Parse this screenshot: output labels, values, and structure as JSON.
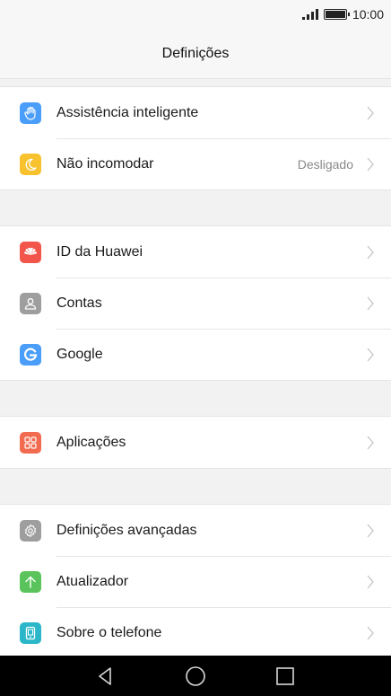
{
  "status_bar": {
    "time": "10:00"
  },
  "header": {
    "title": "Definições"
  },
  "groups": [
    {
      "items": [
        {
          "label": "Assistência inteligente",
          "value": "",
          "icon": "hand-icon",
          "color": "#4a9df8"
        },
        {
          "label": "Não incomodar",
          "value": "Desligado",
          "icon": "moon-icon",
          "color": "#f7c22e"
        }
      ]
    },
    {
      "items": [
        {
          "label": "ID da Huawei",
          "value": "",
          "icon": "huawei-icon",
          "color": "#f2564a"
        },
        {
          "label": "Contas",
          "value": "",
          "icon": "user-icon",
          "color": "#9e9e9e"
        },
        {
          "label": "Google",
          "value": "",
          "icon": "google-icon",
          "color": "#4a9df8"
        }
      ]
    },
    {
      "items": [
        {
          "label": "Aplicações",
          "value": "",
          "icon": "apps-icon",
          "color": "#f26a4f"
        }
      ]
    },
    {
      "items": [
        {
          "label": "Definições avançadas",
          "value": "",
          "icon": "gear-icon",
          "color": "#9e9e9e"
        },
        {
          "label": "Atualizador",
          "value": "",
          "icon": "arrow-up-icon",
          "color": "#5bc35b"
        },
        {
          "label": "Sobre o telefone",
          "value": "",
          "icon": "phone-icon",
          "color": "#2bb7c9"
        }
      ]
    }
  ]
}
